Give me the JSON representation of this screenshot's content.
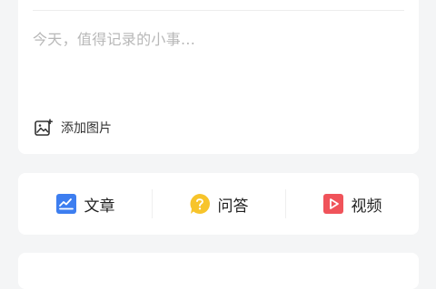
{
  "compose": {
    "placeholder": "今天，值得记录的小事...",
    "add_image_label": "添加图片",
    "add_image_icon": "image-plus-icon"
  },
  "post_types": [
    {
      "label": "文章",
      "icon": "article-icon",
      "color": "#3d7ef0"
    },
    {
      "label": "问答",
      "icon": "question-icon",
      "color": "#f7c42b"
    },
    {
      "label": "视频",
      "icon": "video-icon",
      "color": "#f0535a"
    }
  ],
  "bottom_card": {
    "title": ""
  }
}
